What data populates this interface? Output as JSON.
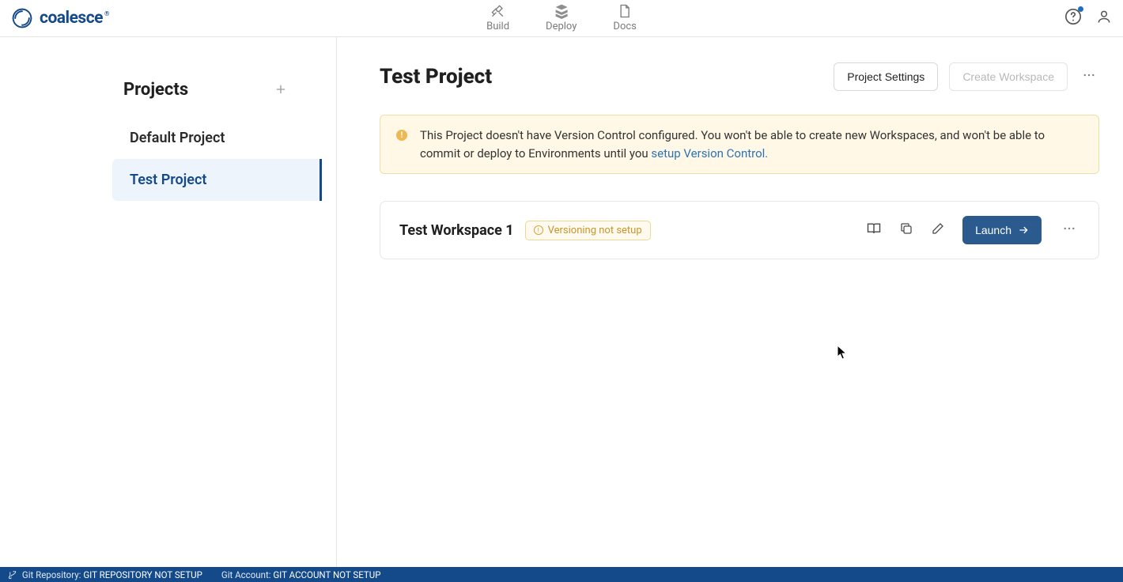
{
  "brand": "coalesce",
  "nav": {
    "build": "Build",
    "deploy": "Deploy",
    "docs": "Docs"
  },
  "sidebar": {
    "title": "Projects",
    "projects": [
      {
        "label": "Default Project"
      },
      {
        "label": "Test Project"
      }
    ]
  },
  "page": {
    "title": "Test Project",
    "settings_btn": "Project Settings",
    "create_ws_btn": "Create Workspace"
  },
  "alert": {
    "text_before": "This Project doesn't have Version Control configured. You won't be able to create new Workspaces, and won't be able to commit or deploy to Environments until you ",
    "link": "setup Version Control."
  },
  "workspace": {
    "name": "Test Workspace 1",
    "badge": "Versioning not setup",
    "launch": "Launch"
  },
  "status": {
    "repo_label": "Git Repository: ",
    "repo_val": "GIT REPOSITORY NOT SETUP",
    "acct_label": "Git Account: ",
    "acct_val": "GIT ACCOUNT NOT SETUP"
  }
}
